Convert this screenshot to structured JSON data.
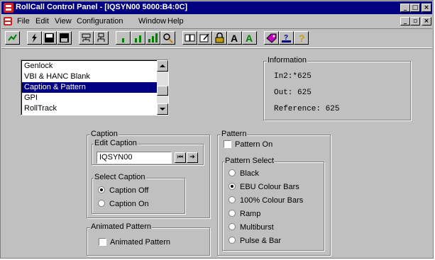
{
  "window": {
    "title": "RollCall Control Panel - [IQSYN00 5000:B4:0C]"
  },
  "menu": [
    "File",
    "Edit",
    "View",
    "Configuration",
    "Window",
    "Help"
  ],
  "list": {
    "items": [
      "Genlock",
      "VBI & HANC Blank",
      "Caption & Pattern",
      "GPI",
      "RollTrack"
    ],
    "selected": "Caption & Pattern"
  },
  "information": {
    "label": "Information",
    "in2": "In2:*625",
    "out": "Out: 625",
    "reference": "Reference: 625"
  },
  "caption": {
    "label": "Caption",
    "edit_label": "Edit Caption",
    "edit_value": "IQSYN00",
    "select_label": "Select Caption",
    "options": [
      "Caption Off",
      "Caption On"
    ],
    "selected": "Caption Off"
  },
  "animated": {
    "label": "Animated Pattern",
    "checkbox_label": "Animated Pattern",
    "checked": false
  },
  "pattern": {
    "label": "Pattern",
    "pattern_on_label": "Pattern On",
    "pattern_on": false,
    "select_label": "Pattern Select",
    "options": [
      "Black",
      "EBU Colour Bars",
      "100% Colour Bars",
      "Ramp",
      "Multiburst",
      "Pulse & Bar"
    ],
    "selected": "EBU Colour Bars"
  },
  "colors": {
    "titlebar": "#000080",
    "face": "#c0c0c0",
    "selection": "#000080"
  },
  "icons": [
    "app-icon",
    "minimize-icon",
    "maximize-icon",
    "close-icon"
  ]
}
